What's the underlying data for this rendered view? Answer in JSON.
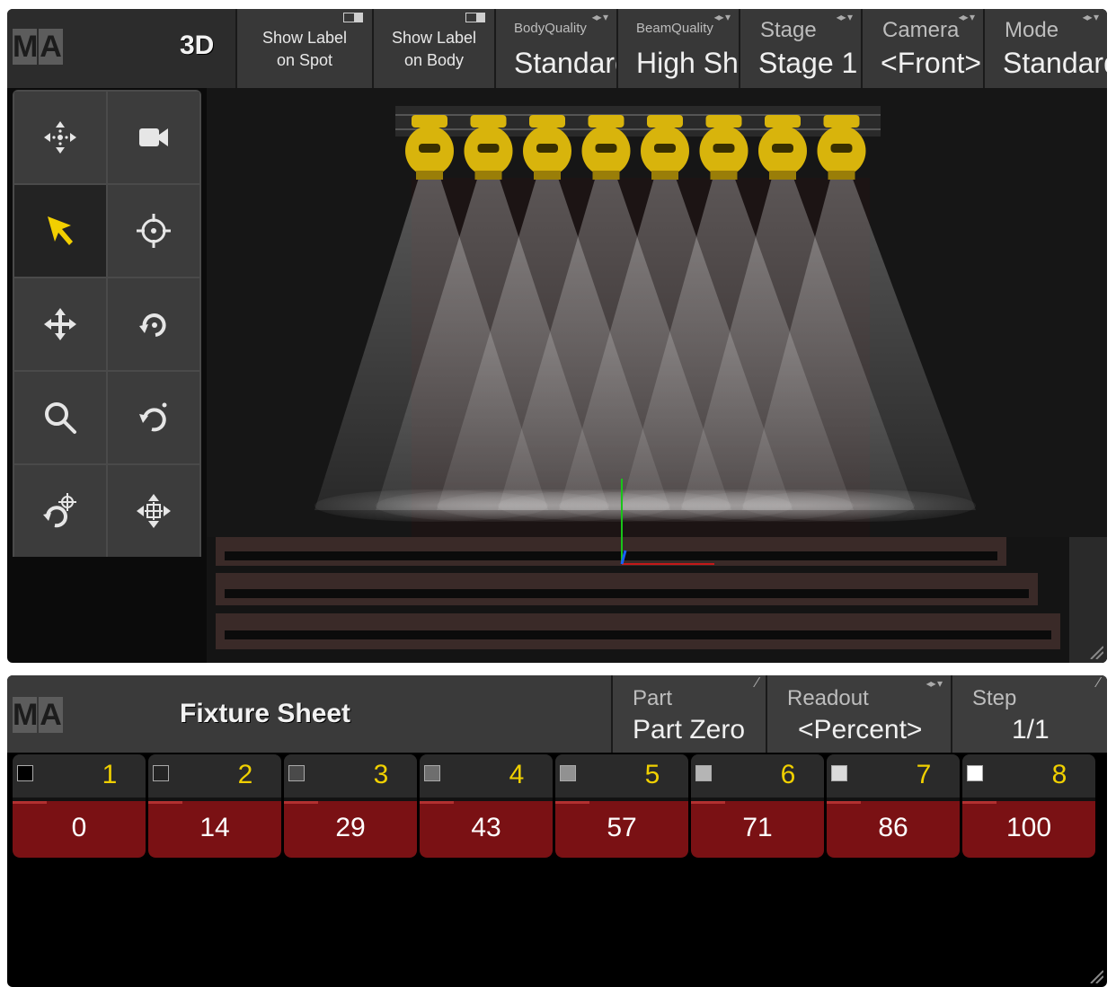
{
  "view3d": {
    "logo": [
      "M",
      "A"
    ],
    "title": "3D",
    "toggles": [
      {
        "line1": "Show Label",
        "line2": "on Spot"
      },
      {
        "line1": "Show Label",
        "line2": "on Body"
      }
    ],
    "selectors": [
      {
        "label": "BodyQuality",
        "value": "Standard"
      },
      {
        "label": "BeamQuality",
        "value": "High Sha"
      },
      {
        "label": "Stage",
        "value": "Stage 1"
      },
      {
        "label": "Camera",
        "value": "<Front>"
      },
      {
        "label": "Mode",
        "value": "Standard"
      }
    ],
    "tools": [
      "move-view-icon",
      "camera-icon",
      "select-arrow-icon",
      "target-icon",
      "move-icon",
      "rotate-icon",
      "zoom-icon",
      "rotate-ccw-icon",
      "rotate-target-icon",
      "move-center-icon"
    ],
    "fixture_count": 8,
    "fixture_color": "#d8b40c"
  },
  "fixture_sheet": {
    "logo": [
      "M",
      "A"
    ],
    "title": "Fixture Sheet",
    "part": {
      "label": "Part",
      "value": "Part Zero"
    },
    "readout": {
      "label": "Readout",
      "value": "<Percent>"
    },
    "step": {
      "label": "Step",
      "value": "1/1"
    },
    "fixtures": [
      {
        "id": "1",
        "value": "0",
        "dimmer": 0
      },
      {
        "id": "2",
        "value": "14",
        "dimmer": 14
      },
      {
        "id": "3",
        "value": "29",
        "dimmer": 29
      },
      {
        "id": "4",
        "value": "43",
        "dimmer": 43
      },
      {
        "id": "5",
        "value": "57",
        "dimmer": 57
      },
      {
        "id": "6",
        "value": "71",
        "dimmer": 71
      },
      {
        "id": "7",
        "value": "86",
        "dimmer": 86
      },
      {
        "id": "8",
        "value": "100",
        "dimmer": 100
      }
    ],
    "accent_yellow": "#f0d000",
    "value_bg": "#7a1114"
  }
}
